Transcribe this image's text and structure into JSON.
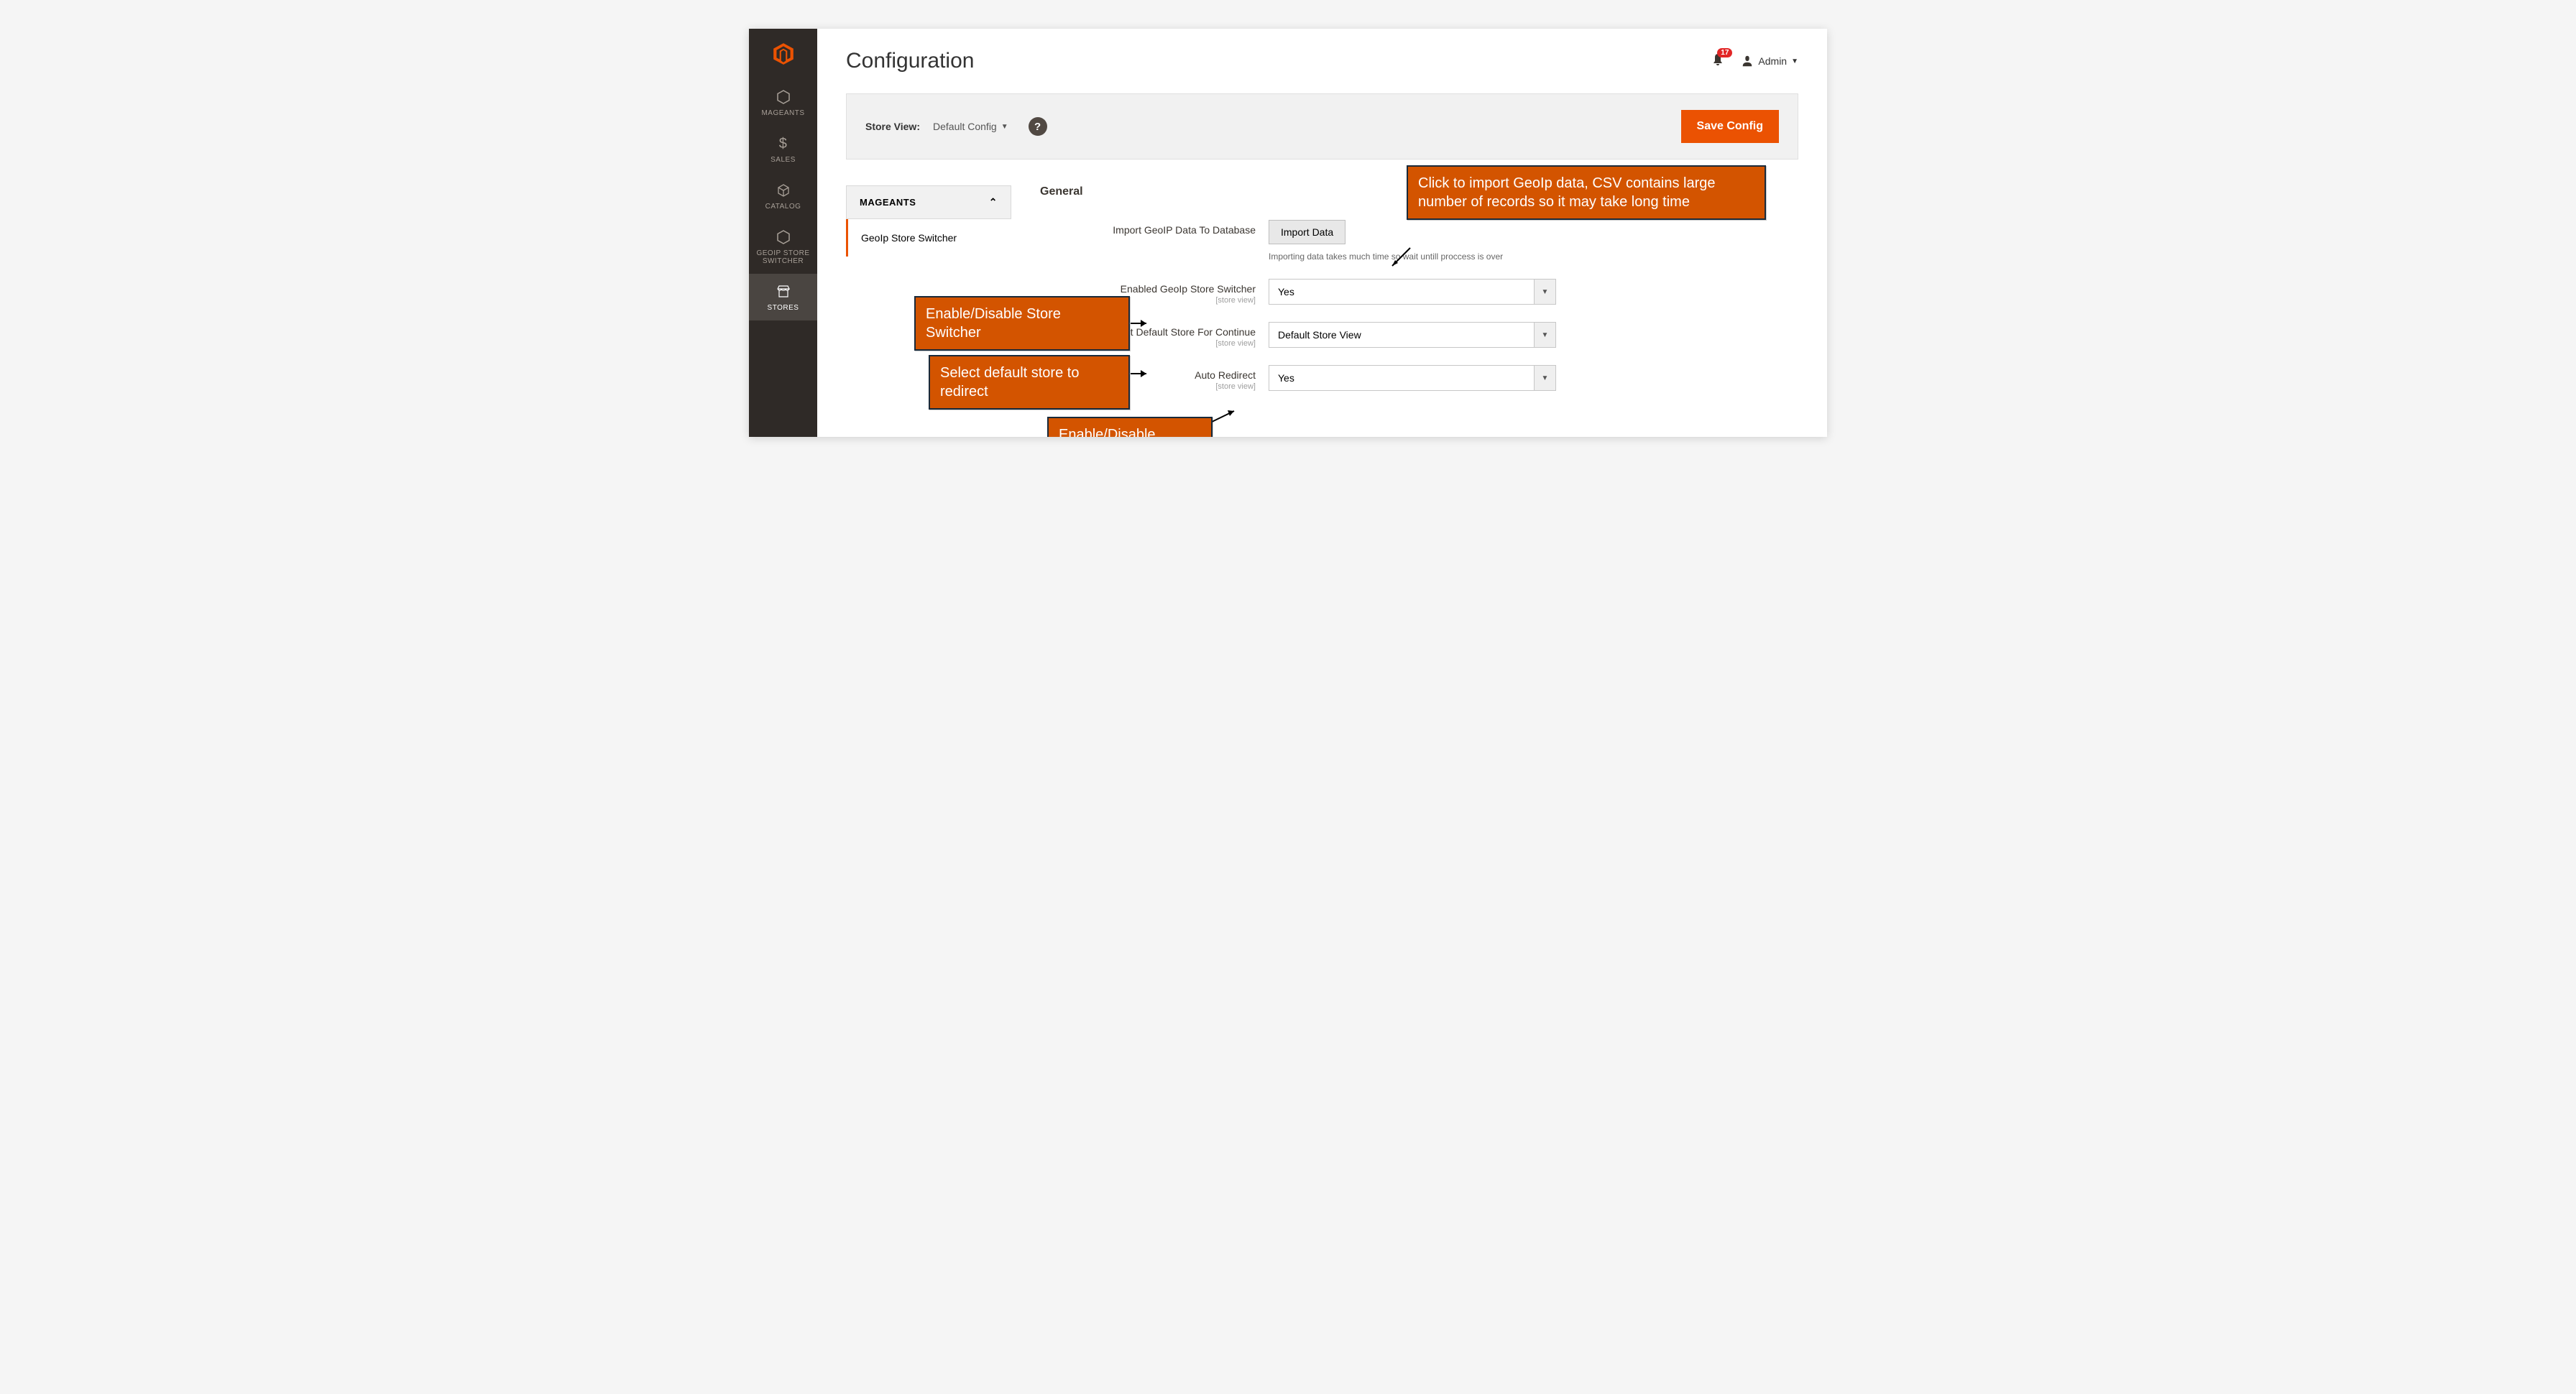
{
  "colors": {
    "accent": "#eb5202",
    "sidebar": "#2f2a27",
    "callout": "#d35400"
  },
  "sidebar": {
    "items": [
      {
        "id": "mageants",
        "label": "MAGEANTS",
        "icon": "hexagon"
      },
      {
        "id": "sales",
        "label": "SALES",
        "icon": "dollar"
      },
      {
        "id": "catalog",
        "label": "CATALOG",
        "icon": "box"
      },
      {
        "id": "geoip",
        "label": "GEOIP STORE SWITCHER",
        "icon": "hexagon"
      },
      {
        "id": "stores",
        "label": "STORES",
        "icon": "store",
        "active": true
      }
    ]
  },
  "header": {
    "title": "Configuration",
    "notification_count": "17",
    "user_name": "Admin"
  },
  "store_view_bar": {
    "label": "Store View:",
    "selected": "Default Config",
    "save_button": "Save Config"
  },
  "config_nav": {
    "group": "MAGEANTS",
    "item": "GeoIp Store Switcher"
  },
  "section": {
    "title": "General",
    "fields": {
      "import": {
        "label": "Import GeoIP Data To Database",
        "button": "Import Data",
        "note": "Importing data takes much time so wait untill proccess is over"
      },
      "enabled": {
        "label": "Enabled GeoIp Store Switcher",
        "scope": "[store view]",
        "value": "Yes"
      },
      "default_store": {
        "label": "Set Default Store For Continue",
        "scope": "[store view]",
        "value": "Default Store View"
      },
      "auto_redirect": {
        "label": "Auto Redirect",
        "scope": "[store view]",
        "value": "Yes"
      }
    }
  },
  "callouts": {
    "import": "Click to import GeoIp data, CSV contains large number of records so it  may take long time",
    "enabled": "Enable/Disable Store Switcher",
    "default_store": "Select default store to redirect",
    "auto_redirect": "Enable/Disable Autoredirection"
  }
}
